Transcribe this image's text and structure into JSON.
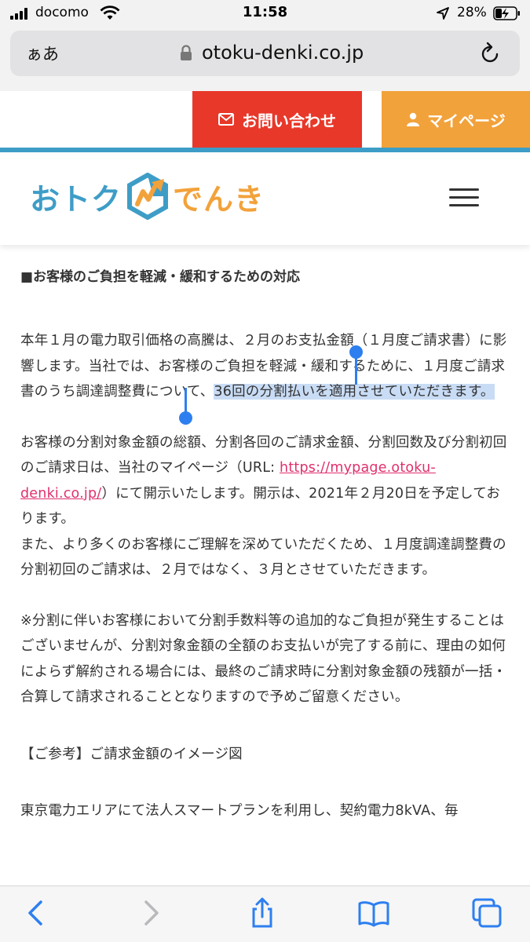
{
  "status_bar": {
    "carrier": "docomo",
    "time": "11:58",
    "battery": "28%"
  },
  "browser": {
    "text_size_button": "ぁあ",
    "url": "otoku-denki.co.jp"
  },
  "header": {
    "contact_label": "お問い合わせ",
    "mypage_label": "マイページ",
    "logo_left": "おトク",
    "logo_right": "でんき",
    "colors": {
      "contact": "#e8382a",
      "mypage": "#f2a23b",
      "brand_blue": "#3e9dc7"
    }
  },
  "article": {
    "title": "■お客様のご負担を軽減・緩和するための対応",
    "p1_before": "本年１月の電力取引価格の高騰は、２月のお支払金額（１月度ご請求書）に影響します。当社では、お客様のご負担を軽減・緩和するために、１月度ご請求書のうち調達調整費について、",
    "p1_selected": "36回の分割払いを適用させていただきます。",
    "p2_before": "お客様の分割対象金額の総額、分割各回のご請求金額、分割回数及び分割初回のご請求日は、当社のマイページ（URL: ",
    "p2_link": "https://mypage.otoku-denki.co.jp/",
    "p2_after": "）にて開示いたします。開示は、2021年２月20日を予定しております。",
    "p3": "また、より多くのお客様にご理解を深めていただくため、１月度調達調整費の分割初回のご請求は、２月ではなく、３月とさせていただきます。",
    "p4": "※分割に伴いお客様において分割手数料等の追加的なご負担が発生することはございませんが、分割対象金額の全額のお支払いが完了する前に、理由の如何によらず解約される場合には、最終のご請求時に分割対象金額の残額が一括・合算して請求されることとなりますので予めご留意ください。",
    "p5": "【ご参考】ご請求金額のイメージ図",
    "p6": "東京電力エリアにて法人スマートプランを利用し、契約電力8kVA、毎"
  },
  "toolbar": {
    "icons": [
      "back-icon",
      "forward-icon",
      "share-icon",
      "bookmarks-icon",
      "tabs-icon"
    ]
  }
}
